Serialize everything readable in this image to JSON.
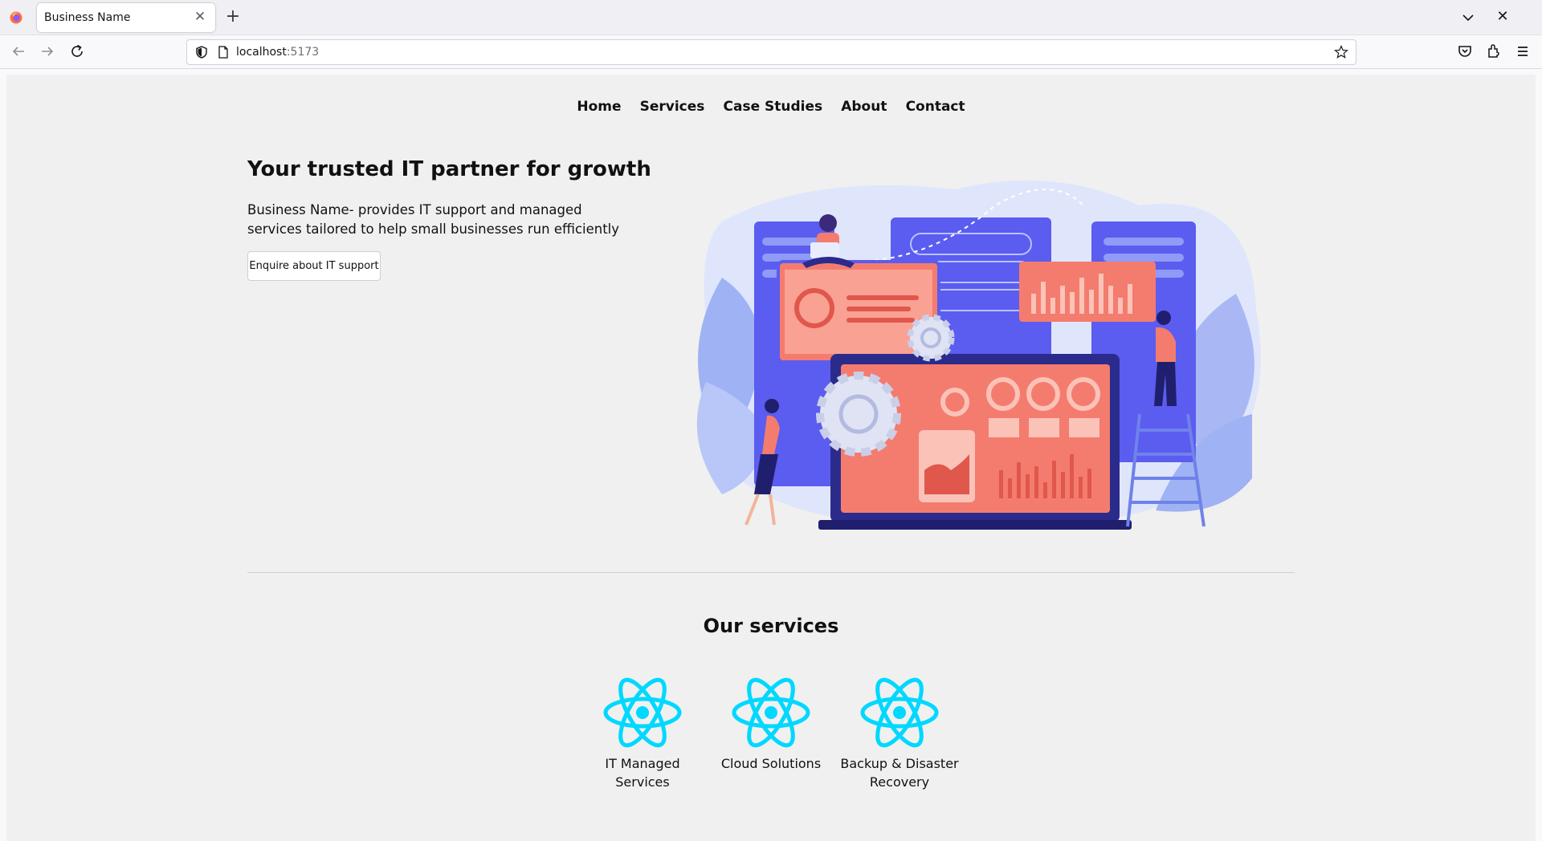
{
  "browser": {
    "tab_title": "Business Name",
    "url_host": "localhost",
    "url_port": ":5173",
    "icons": [
      "firefox-logo-icon",
      "close-icon",
      "plus-icon",
      "chevron-down-icon",
      "back-icon",
      "forward-icon",
      "reload-icon",
      "shield-icon",
      "page-icon",
      "star-icon",
      "pocket-icon",
      "extensions-icon",
      "menu-icon"
    ]
  },
  "site": {
    "nav": [
      "Home",
      "Services",
      "Case Studies",
      "About",
      "Contact"
    ],
    "hero": {
      "title": "Your trusted IT partner for growth",
      "text": "Business Name- provides IT support and managed services tailored to help small businesses run efficiently",
      "cta_label": "Enquire about IT support"
    },
    "services_title": "Our services",
    "services": [
      {
        "label": "IT Managed Services",
        "icon": "react-atom-icon"
      },
      {
        "label": "Cloud Solutions",
        "icon": "react-atom-icon"
      },
      {
        "label": "Backup & Disaster Recovery",
        "icon": "react-atom-icon"
      }
    ]
  },
  "colors": {
    "page_bg": "#f0f0f0",
    "illustration_blue": "#5b5cf0",
    "illustration_coral": "#f47c6e",
    "illustration_lightblue": "#a9b8f5",
    "react_cyan": "#00d8ff"
  }
}
